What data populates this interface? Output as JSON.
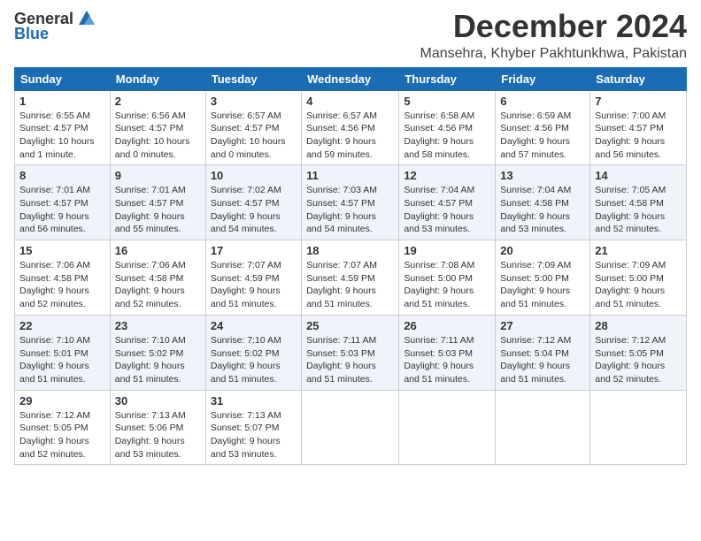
{
  "header": {
    "logo_general": "General",
    "logo_blue": "Blue",
    "month_title": "December 2024",
    "location": "Mansehra, Khyber Pakhtunkhwa, Pakistan"
  },
  "weekdays": [
    "Sunday",
    "Monday",
    "Tuesday",
    "Wednesday",
    "Thursday",
    "Friday",
    "Saturday"
  ],
  "weeks": [
    [
      {
        "day": 1,
        "sunrise": "6:55 AM",
        "sunset": "4:57 PM",
        "daylight": "10 hours and 1 minute."
      },
      {
        "day": 2,
        "sunrise": "6:56 AM",
        "sunset": "4:57 PM",
        "daylight": "10 hours and 0 minutes."
      },
      {
        "day": 3,
        "sunrise": "6:57 AM",
        "sunset": "4:57 PM",
        "daylight": "10 hours and 0 minutes."
      },
      {
        "day": 4,
        "sunrise": "6:57 AM",
        "sunset": "4:56 PM",
        "daylight": "9 hours and 59 minutes."
      },
      {
        "day": 5,
        "sunrise": "6:58 AM",
        "sunset": "4:56 PM",
        "daylight": "9 hours and 58 minutes."
      },
      {
        "day": 6,
        "sunrise": "6:59 AM",
        "sunset": "4:56 PM",
        "daylight": "9 hours and 57 minutes."
      },
      {
        "day": 7,
        "sunrise": "7:00 AM",
        "sunset": "4:57 PM",
        "daylight": "9 hours and 56 minutes."
      }
    ],
    [
      {
        "day": 8,
        "sunrise": "7:01 AM",
        "sunset": "4:57 PM",
        "daylight": "9 hours and 56 minutes."
      },
      {
        "day": 9,
        "sunrise": "7:01 AM",
        "sunset": "4:57 PM",
        "daylight": "9 hours and 55 minutes."
      },
      {
        "day": 10,
        "sunrise": "7:02 AM",
        "sunset": "4:57 PM",
        "daylight": "9 hours and 54 minutes."
      },
      {
        "day": 11,
        "sunrise": "7:03 AM",
        "sunset": "4:57 PM",
        "daylight": "9 hours and 54 minutes."
      },
      {
        "day": 12,
        "sunrise": "7:04 AM",
        "sunset": "4:57 PM",
        "daylight": "9 hours and 53 minutes."
      },
      {
        "day": 13,
        "sunrise": "7:04 AM",
        "sunset": "4:58 PM",
        "daylight": "9 hours and 53 minutes."
      },
      {
        "day": 14,
        "sunrise": "7:05 AM",
        "sunset": "4:58 PM",
        "daylight": "9 hours and 52 minutes."
      }
    ],
    [
      {
        "day": 15,
        "sunrise": "7:06 AM",
        "sunset": "4:58 PM",
        "daylight": "9 hours and 52 minutes."
      },
      {
        "day": 16,
        "sunrise": "7:06 AM",
        "sunset": "4:58 PM",
        "daylight": "9 hours and 52 minutes."
      },
      {
        "day": 17,
        "sunrise": "7:07 AM",
        "sunset": "4:59 PM",
        "daylight": "9 hours and 51 minutes."
      },
      {
        "day": 18,
        "sunrise": "7:07 AM",
        "sunset": "4:59 PM",
        "daylight": "9 hours and 51 minutes."
      },
      {
        "day": 19,
        "sunrise": "7:08 AM",
        "sunset": "5:00 PM",
        "daylight": "9 hours and 51 minutes."
      },
      {
        "day": 20,
        "sunrise": "7:09 AM",
        "sunset": "5:00 PM",
        "daylight": "9 hours and 51 minutes."
      },
      {
        "day": 21,
        "sunrise": "7:09 AM",
        "sunset": "5:00 PM",
        "daylight": "9 hours and 51 minutes."
      }
    ],
    [
      {
        "day": 22,
        "sunrise": "7:10 AM",
        "sunset": "5:01 PM",
        "daylight": "9 hours and 51 minutes."
      },
      {
        "day": 23,
        "sunrise": "7:10 AM",
        "sunset": "5:02 PM",
        "daylight": "9 hours and 51 minutes."
      },
      {
        "day": 24,
        "sunrise": "7:10 AM",
        "sunset": "5:02 PM",
        "daylight": "9 hours and 51 minutes."
      },
      {
        "day": 25,
        "sunrise": "7:11 AM",
        "sunset": "5:03 PM",
        "daylight": "9 hours and 51 minutes."
      },
      {
        "day": 26,
        "sunrise": "7:11 AM",
        "sunset": "5:03 PM",
        "daylight": "9 hours and 51 minutes."
      },
      {
        "day": 27,
        "sunrise": "7:12 AM",
        "sunset": "5:04 PM",
        "daylight": "9 hours and 51 minutes."
      },
      {
        "day": 28,
        "sunrise": "7:12 AM",
        "sunset": "5:05 PM",
        "daylight": "9 hours and 52 minutes."
      }
    ],
    [
      {
        "day": 29,
        "sunrise": "7:12 AM",
        "sunset": "5:05 PM",
        "daylight": "9 hours and 52 minutes."
      },
      {
        "day": 30,
        "sunrise": "7:13 AM",
        "sunset": "5:06 PM",
        "daylight": "9 hours and 53 minutes."
      },
      {
        "day": 31,
        "sunrise": "7:13 AM",
        "sunset": "5:07 PM",
        "daylight": "9 hours and 53 minutes."
      },
      null,
      null,
      null,
      null
    ]
  ]
}
